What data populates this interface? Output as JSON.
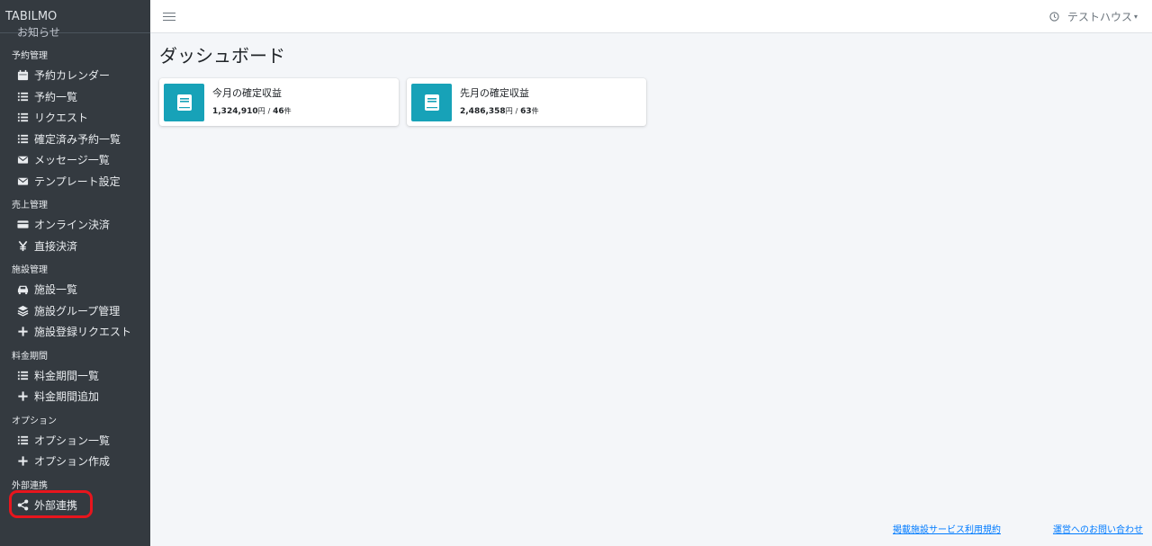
{
  "sidebar": {
    "brand": "TABILMO",
    "clipped_item": "お知らせ",
    "sections": [
      {
        "title": "予約管理",
        "items": [
          {
            "label": "予約カレンダー",
            "icon": "calendar-icon"
          },
          {
            "label": "予約一覧",
            "icon": "list-icon"
          },
          {
            "label": "リクエスト",
            "icon": "list-icon"
          },
          {
            "label": "確定済み予約一覧",
            "icon": "list-icon"
          },
          {
            "label": "メッセージ一覧",
            "icon": "envelope-icon"
          },
          {
            "label": "テンプレート設定",
            "icon": "envelope-icon"
          }
        ]
      },
      {
        "title": "売上管理",
        "items": [
          {
            "label": "オンライン決済",
            "icon": "credit-card-icon"
          },
          {
            "label": "直接決済",
            "icon": "yen-icon"
          }
        ]
      },
      {
        "title": "施設管理",
        "items": [
          {
            "label": "施設一覧",
            "icon": "car-icon"
          },
          {
            "label": "施設グループ管理",
            "icon": "layers-icon"
          },
          {
            "label": "施設登録リクエスト",
            "icon": "plus-icon"
          }
        ]
      },
      {
        "title": "料金期間",
        "items": [
          {
            "label": "料金期間一覧",
            "icon": "list-icon"
          },
          {
            "label": "料金期間追加",
            "icon": "plus-icon"
          }
        ]
      },
      {
        "title": "オプション",
        "items": [
          {
            "label": "オプション一覧",
            "icon": "list-icon"
          },
          {
            "label": "オプション作成",
            "icon": "plus-icon"
          }
        ]
      },
      {
        "title": "外部連携",
        "items": [
          {
            "label": "外部連携",
            "icon": "share-icon",
            "highlighted": true
          }
        ]
      }
    ]
  },
  "topbar": {
    "user_name": "テストハウス",
    "caret": "▾"
  },
  "main": {
    "page_title": "ダッシュボード",
    "cards": [
      {
        "label": "今月の確定収益",
        "amount": "1,324,910",
        "amount_unit": "円",
        "separator": "/",
        "count": "46",
        "count_unit": "件"
      },
      {
        "label": "先月の確定収益",
        "amount": "2,486,358",
        "amount_unit": "円",
        "separator": "/",
        "count": "63",
        "count_unit": "件"
      }
    ]
  },
  "footer": {
    "links": [
      "掲載施設サービス利用規約",
      "運営へのお問い合わせ"
    ]
  },
  "colors": {
    "sidebar_bg": "#343a40",
    "card_icon_bg": "#17a2b8",
    "highlight_ring": "#e8151d",
    "link": "#007bff"
  }
}
